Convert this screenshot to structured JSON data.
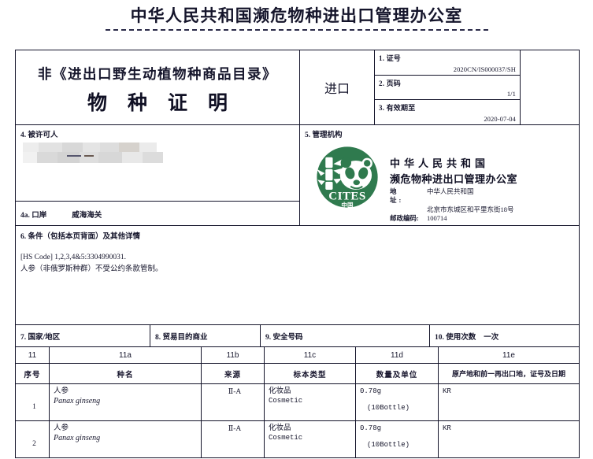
{
  "masthead": {
    "title": "中华人民共和国濒危物种进出口管理办公室"
  },
  "header": {
    "lead_line": "非《进出口野生动植物种商品目录》",
    "big_line": "物种证明",
    "direction": "进口",
    "fields": [
      {
        "label": "1. 证号",
        "value": "2020CN/IS000037/SH"
      },
      {
        "label": "2. 页码",
        "value": "1/1"
      },
      {
        "label": "3. 有效期至",
        "value": "2020-07-04"
      }
    ]
  },
  "licensee": {
    "label": "4. 被许可人",
    "value": "",
    "port_label": "4a. 口岸",
    "port_value": "威海海关"
  },
  "authority": {
    "label": "5. 管理机构",
    "logo": {
      "name": "cites-panda-logo",
      "text": "CITES",
      "subtext": "中国",
      "color": "#2f7a4e"
    },
    "name_line1": "中华人民共和国",
    "name_line2": "濒危物种进出口管理办公室",
    "address_label": "地　　址:",
    "address_line1": "中华人民共和国",
    "address_line2": "北京市东城区和平里东街18号",
    "postcode_label": "邮政编码:",
    "postcode_value": "100714"
  },
  "conditions": {
    "label": "6. 条件（包括本页背面）及其他详情",
    "line1": "[HS Code] 1,2,3,4&5:3304990031.",
    "line2": "人参（非俄罗斯种群）不受公约条款管制。"
  },
  "fields_7_10": [
    {
      "label": "7. 国家/地区",
      "value": ""
    },
    {
      "label": "8. 贸易目的商业",
      "value": ""
    },
    {
      "label": "9. 安全号码",
      "value": ""
    },
    {
      "label": "10. 使用次数",
      "value": "一次"
    }
  ],
  "species_table": {
    "code_headers": [
      "11",
      "11a",
      "11b",
      "11c",
      "11d",
      "11e"
    ],
    "headers": [
      "序号",
      "种名",
      "来源",
      "标本类型",
      "数量及单位",
      "原产地和前一再出口地，证号及日期"
    ],
    "rows": [
      {
        "no": "1",
        "name_cn": "人参",
        "name_la": "Panax ginseng",
        "source": "Ⅱ-A",
        "type_cn": "化妆品",
        "type_en": "Cosmetic",
        "qty": "0.78g",
        "qty_sub": "(10Bottle)",
        "origin": "KR"
      },
      {
        "no": "2",
        "name_cn": "人参",
        "name_la": "Panax ginseng",
        "source": "Ⅱ-A",
        "type_cn": "化妆品",
        "type_en": "Cosmetic",
        "qty": "0.78g",
        "qty_sub": "(10Bottle)",
        "origin": "KR"
      }
    ]
  }
}
